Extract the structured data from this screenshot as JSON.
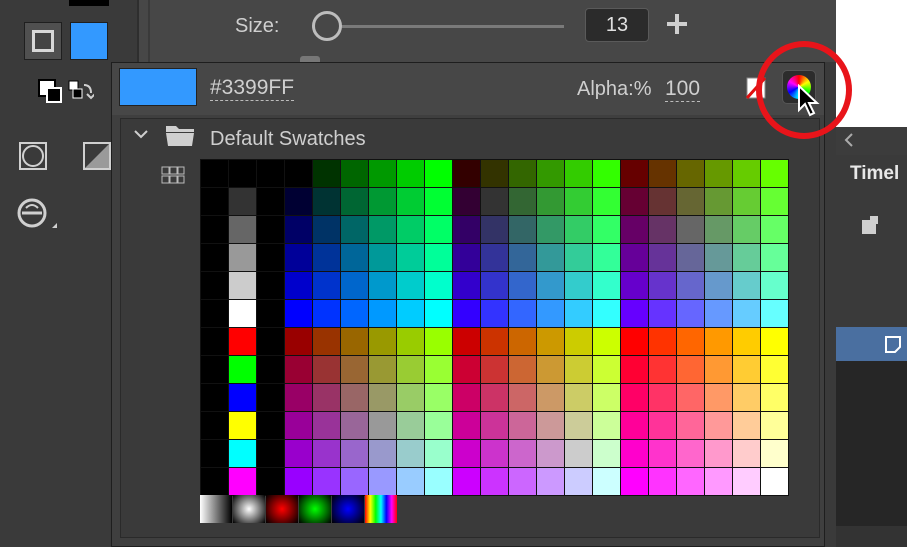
{
  "props": {
    "size_label": "Size:",
    "size_value": "13",
    "size_slider_fraction": 0.0,
    "plus_symbol": "+"
  },
  "popup": {
    "current_color": "#3399FF",
    "hex_label": "#3399FF",
    "alpha_label": "Alpha:%",
    "alpha_value": "100"
  },
  "swatches": {
    "folder_label": "Default Swatches",
    "grays": [
      "#000000",
      "#333333",
      "#666666",
      "#999999",
      "#cccccc",
      "#ffffff"
    ],
    "primaries": [
      "#ff0000",
      "#00ff00",
      "#0000ff",
      "#ffff00",
      "#00ffff",
      "#ff00ff"
    ],
    "gradients": [
      "gray-linear",
      "gray-radial",
      "red-radial",
      "green-radial",
      "blue-radial",
      "rainbow-linear"
    ]
  },
  "timeline": {
    "title": "Timel"
  },
  "colors": {
    "accent": "#3399FF",
    "callout": "#e8141a"
  },
  "icons": [
    "fill-color-icon",
    "stroke-color-icon",
    "default-colors-icon",
    "swap-colors-icon",
    "object-drawing-icon",
    "snap-icon",
    "smooth-icon",
    "no-color-icon",
    "color-picker-icon",
    "chevron-down-icon",
    "folder-icon",
    "grid-view-icon",
    "mouse-cursor-icon",
    "plus-icon",
    "chevron-left-icon"
  ]
}
